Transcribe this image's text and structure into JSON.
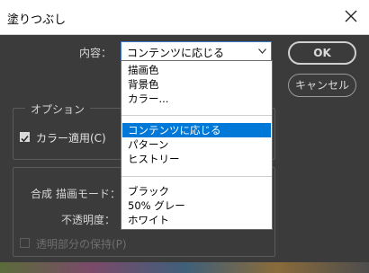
{
  "window": {
    "title": "塗りつぶし"
  },
  "contents": {
    "label": "内容：",
    "selected": "コンテンツに応じる",
    "options_group1": [
      "描画色",
      "背景色",
      "カラー..."
    ],
    "options_group2": [
      "コンテンツに応じる",
      "パターン",
      "ヒストリー"
    ],
    "options_group3": [
      "ブラック",
      "50% グレー",
      "ホワイト"
    ]
  },
  "buttons": {
    "ok": "OK",
    "cancel": "キャンセル"
  },
  "options": {
    "title": "オプション",
    "color_adapt": {
      "label": "カラー適用(C)",
      "checked": true
    }
  },
  "blending": {
    "title": "合成",
    "mode_label": "描画モード：",
    "opacity_label": "不透明度：",
    "preserve_transparency": {
      "label": "透明部分の保持(P)",
      "checked": false
    }
  },
  "colors": {
    "accent": "#0078d7",
    "dialog_bg": "#3b3b3b"
  },
  "icons": {
    "close": "close-icon",
    "dropdown": "chevron-down-icon"
  }
}
